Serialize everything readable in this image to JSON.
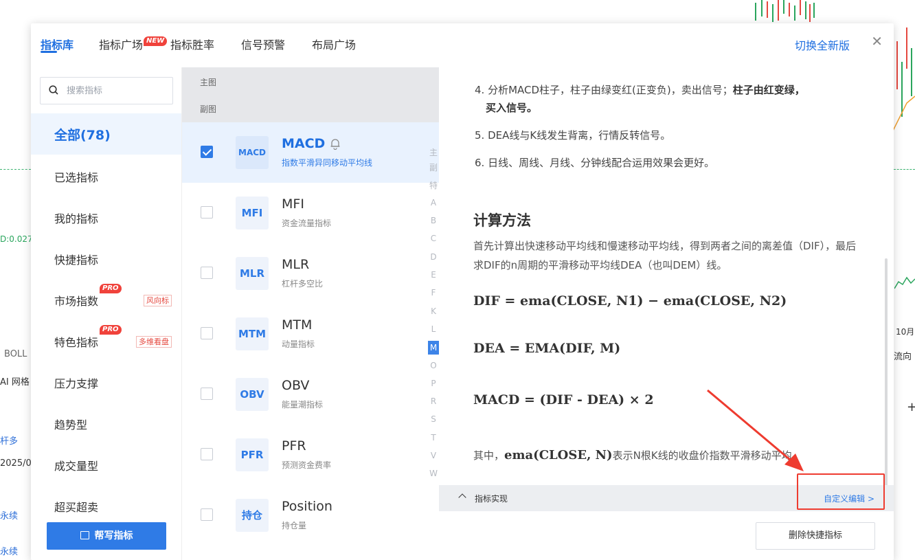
{
  "tabs": [
    {
      "label": "指标库",
      "active": true
    },
    {
      "label": "指标广场",
      "badge": "NEW"
    },
    {
      "label": "指标胜率"
    },
    {
      "label": "信号预警"
    },
    {
      "label": "布局广场"
    }
  ],
  "header": {
    "switch_version": "切换全新版",
    "close_icon": "close-icon"
  },
  "sidebar": {
    "search_placeholder": "搜索指标",
    "categories": [
      {
        "label": "全部(78)",
        "active": true
      },
      {
        "label": "已选指标"
      },
      {
        "label": "我的指标"
      },
      {
        "label": "快捷指标"
      },
      {
        "label": "市场指数",
        "badge": "PRO",
        "tag": "风向标"
      },
      {
        "label": "特色指标",
        "badge": "PRO",
        "tag": "多维看盘"
      },
      {
        "label": "压力支撑"
      },
      {
        "label": "趋势型"
      },
      {
        "label": "成交量型"
      },
      {
        "label": "超买超卖"
      }
    ],
    "help_button": "帮写指标"
  },
  "list": {
    "groups": [
      "主图",
      "副图"
    ],
    "items": [
      {
        "abbr": "MACD",
        "name": "MACD",
        "desc": "指数平滑异同移动平均线",
        "checked": true
      },
      {
        "abbr": "MFI",
        "name": "MFI",
        "desc": "资金流量指标",
        "checked": false
      },
      {
        "abbr": "MLR",
        "name": "MLR",
        "desc": "杠杆多空比",
        "checked": false
      },
      {
        "abbr": "MTM",
        "name": "MTM",
        "desc": "动量指标",
        "checked": false
      },
      {
        "abbr": "OBV",
        "name": "OBV",
        "desc": "能量潮指标",
        "checked": false
      },
      {
        "abbr": "PFR",
        "name": "PFR",
        "desc": "预测资金费率",
        "checked": false
      },
      {
        "abbr": "持仓",
        "name": "Position",
        "desc": "持仓量",
        "checked": false
      }
    ],
    "alphabet": [
      "主",
      "副",
      "特",
      "A",
      "B",
      "C",
      "D",
      "E",
      "F",
      "K",
      "L",
      "M",
      "O",
      "P",
      "R",
      "S",
      "T",
      "V",
      "W"
    ],
    "alphabet_active": "M"
  },
  "detail": {
    "item4_prefix": "4. 分析MACD柱子，柱子由绿变红(正变负)，卖出信号；",
    "item4_bold": "柱子由红变绿，",
    "item4_bold2": "买入信号。",
    "item5": "5. DEA线与K线发生背离，行情反转信号。",
    "item6": "6. 日线、周线、月线、分钟线配合运用效果会更好。",
    "calc_title": "计算方法",
    "calc_desc": "首先计算出快速移动平均线和慢速移动平均线，得到两者之间的离差值（DIF），最后求DIF的n周期的平滑移动平均线DEA（也叫DEM）线。",
    "formula_dif": "DIF = ema(CLOSE, N1) − ema(CLOSE, N2)",
    "formula_dea": "DEA = EMA(DIF, M)",
    "formula_macd": "MACD = (DIF - DEA) × 2",
    "explain_prefix": "其中，",
    "explain_formula": "ema(CLOSE, N)",
    "explain_suffix": "表示N根K线的收盘价指数平滑移动平均。",
    "impl_label": "指标实现",
    "custom_edit": "自定义编辑 >",
    "delete_button": "删除快捷指标"
  },
  "background": {
    "texts": [
      "D:0.027",
      "BOLL",
      "AI 网格",
      "杆多",
      "2025/07",
      "永续",
      "永续",
      "10月",
      "流向",
      "+"
    ]
  }
}
